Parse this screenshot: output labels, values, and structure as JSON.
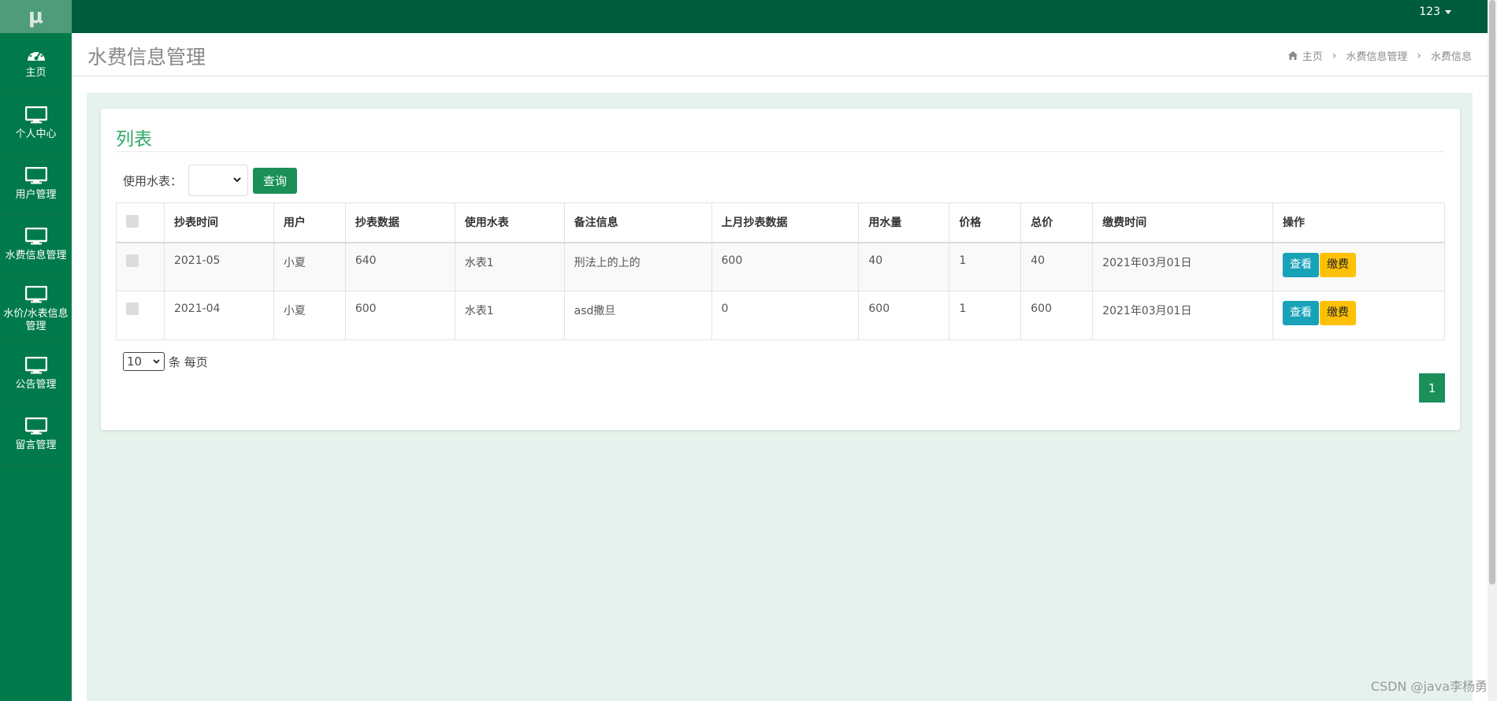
{
  "app": {
    "logo": "μ",
    "user": "123"
  },
  "sidebar": {
    "items": [
      {
        "label": "主页",
        "icon": "dashboard-icon"
      },
      {
        "label": "个人中心",
        "icon": "monitor-icon"
      },
      {
        "label": "用户管理",
        "icon": "monitor-icon"
      },
      {
        "label": "水费信息管理",
        "icon": "monitor-icon"
      },
      {
        "label": "水价/水表信息管理",
        "icon": "monitor-icon"
      },
      {
        "label": "公告管理",
        "icon": "monitor-icon"
      },
      {
        "label": "留言管理",
        "icon": "monitor-icon"
      }
    ]
  },
  "header": {
    "title": "水费信息管理",
    "breadcrumb": [
      "主页",
      "水费信息管理",
      "水费信息"
    ]
  },
  "panel": {
    "title": "列表",
    "filter_label": "使用水表：",
    "filter_value": "",
    "query_button": "查询"
  },
  "table": {
    "columns": [
      "抄表时间",
      "用户",
      "抄表数据",
      "使用水表",
      "备注信息",
      "上月抄表数据",
      "用水量",
      "价格",
      "总价",
      "缴费时间",
      "操作"
    ],
    "rows": [
      {
        "time": "2021-05",
        "user": "小夏",
        "reading": "640",
        "meter": "水表1",
        "note": "刑法上的上的",
        "last_reading": "600",
        "usage": "40",
        "price": "1",
        "total": "40",
        "paid_at": "2021年03月01日"
      },
      {
        "time": "2021-04",
        "user": "小夏",
        "reading": "600",
        "meter": "水表1",
        "note": "asd撒旦",
        "last_reading": "0",
        "usage": "600",
        "price": "1",
        "total": "600",
        "paid_at": "2021年03月01日"
      }
    ],
    "view_label": "查看",
    "pay_label": "缴费"
  },
  "pagination": {
    "page_size": "10",
    "page_size_suffix": "条 每页",
    "current_page": "1"
  },
  "watermark": "CSDN @java李杨勇",
  "colors": {
    "sidebar": "#007a4a",
    "topbar": "#005c3f",
    "accent": "#2ea864",
    "primary_button": "#1a8f57",
    "info_button": "#17a2b8",
    "warning_button": "#ffc107"
  }
}
